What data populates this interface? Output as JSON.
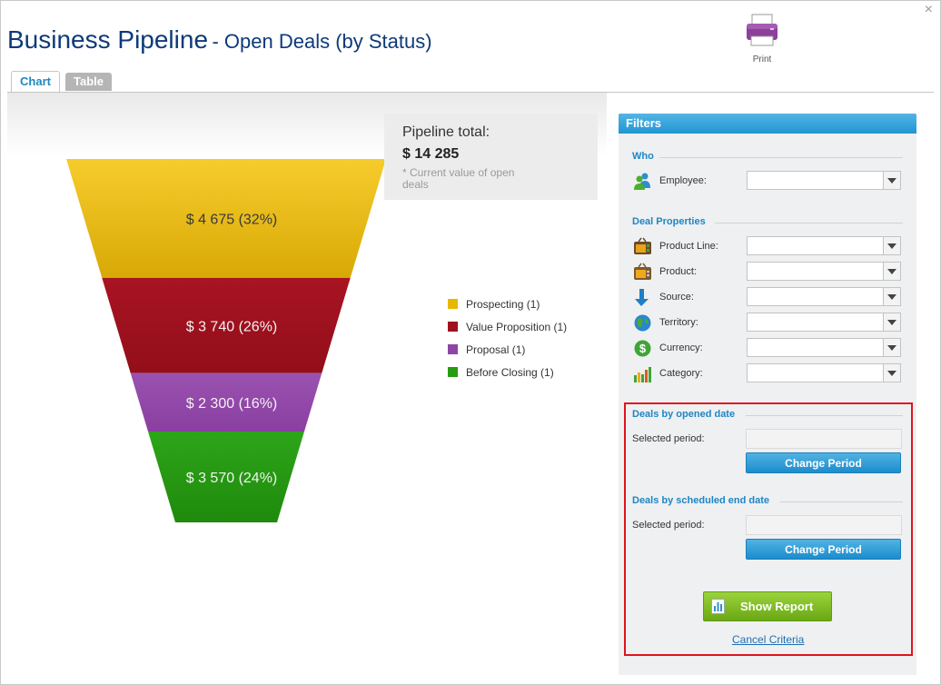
{
  "header": {
    "title_main": "Business Pipeline",
    "title_sub": "- Open Deals (by Status)",
    "print_label": "Print",
    "close_glyph": "×"
  },
  "tabs": [
    {
      "label": "Chart",
      "active": true
    },
    {
      "label": "Table",
      "active": false
    }
  ],
  "pipeline_total": {
    "title": "Pipeline total:",
    "value": "$ 14 285",
    "note": "* Current value of open deals"
  },
  "chart_data": {
    "type": "funnel",
    "stages": [
      {
        "name": "Prospecting",
        "count": 1,
        "value": 4675,
        "label": "$ 4 675 (32%)",
        "color": "#e8b800"
      },
      {
        "name": "Value Proposition",
        "count": 1,
        "value": 3740,
        "label": "$ 3 740 (26%)",
        "color": "#a0121f"
      },
      {
        "name": "Proposal",
        "count": 1,
        "value": 2300,
        "label": "$ 2 300 (16%)",
        "color": "#8e45a4"
      },
      {
        "name": "Before Closing",
        "count": 1,
        "value": 3570,
        "label": "$ 3 570 (24%)",
        "color": "#269b12"
      }
    ],
    "legend": [
      "Prospecting (1)",
      "Value Proposition (1)",
      "Proposal (1)",
      "Before Closing (1)"
    ],
    "legend_position": "right"
  },
  "filters": {
    "title": "Filters",
    "who_heading": "Who",
    "employee_label": "Employee:",
    "deal_props_heading": "Deal Properties",
    "props": [
      {
        "label": "Product Line:",
        "icon": "product-line-icon"
      },
      {
        "label": "Product:",
        "icon": "product-icon"
      },
      {
        "label": "Source:",
        "icon": "source-icon"
      },
      {
        "label": "Territory:",
        "icon": "territory-icon"
      },
      {
        "label": "Currency:",
        "icon": "currency-icon"
      },
      {
        "label": "Category:",
        "icon": "category-icon"
      }
    ],
    "opened_heading": "Deals by opened date",
    "scheduled_heading": "Deals by scheduled end date",
    "selected_period_label": "Selected period:",
    "change_period_label": "Change Period",
    "show_report_label": "Show Report",
    "cancel_label": "Cancel Criteria"
  }
}
